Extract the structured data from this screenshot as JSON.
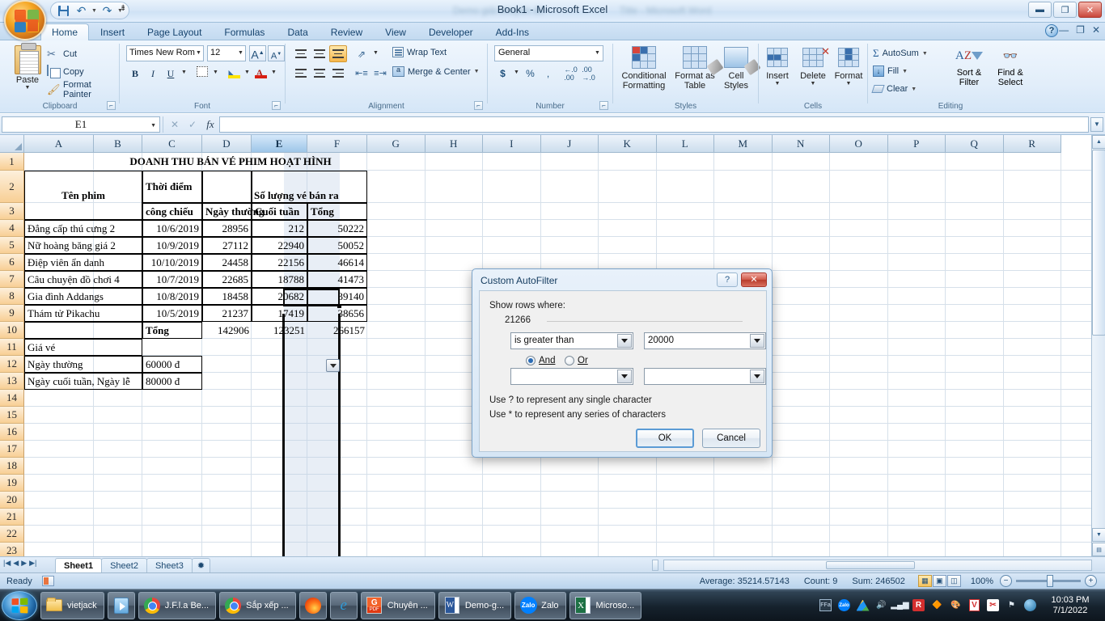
{
  "titlebar": {
    "app_title": "Book1 - Microsoft Excel",
    "blur_left": "Demo giải chuyên đề",
    "blur_right": "Title - Microsoft Word",
    "quick_access": [
      "save-icon",
      "undo-icon",
      "redo-icon",
      "customize-icon"
    ],
    "window_buttons": [
      "minimize",
      "restore",
      "close"
    ]
  },
  "ribbon": {
    "tabs": [
      {
        "label": "Home",
        "active": true
      },
      {
        "label": "Insert",
        "active": false
      },
      {
        "label": "Page Layout",
        "active": false
      },
      {
        "label": "Formulas",
        "active": false
      },
      {
        "label": "Data",
        "active": false
      },
      {
        "label": "Review",
        "active": false
      },
      {
        "label": "View",
        "active": false
      },
      {
        "label": "Developer",
        "active": false
      },
      {
        "label": "Add-Ins",
        "active": false
      }
    ],
    "clipboard": {
      "group_label": "Clipboard",
      "paste": "Paste",
      "cut": "Cut",
      "copy": "Copy",
      "format_painter": "Format Painter"
    },
    "font": {
      "group_label": "Font",
      "font_name": "Times New Rom",
      "font_size": "12",
      "bold": "B",
      "italic": "I",
      "underline": "U"
    },
    "alignment": {
      "group_label": "Alignment",
      "wrap_text": "Wrap Text",
      "merge_center": "Merge & Center"
    },
    "number": {
      "group_label": "Number",
      "format": "General",
      "currency": "$",
      "percent": "%",
      "comma": ","
    },
    "styles": {
      "group_label": "Styles",
      "conditional_formatting": "Conditional Formatting",
      "format_as_table": "Format as Table",
      "cell_styles": "Cell Styles"
    },
    "cells": {
      "group_label": "Cells",
      "insert": "Insert",
      "delete": "Delete",
      "format": "Format"
    },
    "editing": {
      "group_label": "Editing",
      "autosum": "AutoSum",
      "fill": "Fill",
      "clear": "Clear",
      "sort_filter": "Sort & Filter",
      "find_select": "Find & Select"
    }
  },
  "formula_bar": {
    "name_box": "E1",
    "formula_value": ""
  },
  "grid": {
    "columns": [
      "A",
      "B",
      "C",
      "D",
      "E",
      "F",
      "G",
      "H",
      "I",
      "J",
      "K",
      "L",
      "M",
      "N",
      "O",
      "P",
      "Q",
      "R"
    ],
    "selected_column": "E",
    "rows": [
      1,
      2,
      3,
      4,
      5,
      6,
      7,
      8,
      9,
      10,
      11,
      12,
      13,
      14,
      15,
      16,
      17,
      18,
      19,
      20,
      21,
      22,
      23
    ],
    "title_cell": "DOANH THU BÁN VÉ PHIM HOẠT HÌNH",
    "headers": {
      "ten_phim": "Tên phim",
      "thoi_diem": "Thời điểm",
      "cong_chieu": "công chiếu",
      "so_luong": "Số lượng vé bán ra",
      "ngay_thuong": "Ngày thường",
      "cuoi_tuan": "Cuối tuần",
      "tong": "Tổng"
    },
    "data_rows": [
      {
        "row": 4,
        "name": "Đẳng cấp thú cưng 2",
        "date": "10/6/2019",
        "weekday": "28956",
        "weekend": "212",
        "total": "50222"
      },
      {
        "row": 5,
        "name": "Nữ hoàng băng giá 2",
        "date": "10/9/2019",
        "weekday": "27112",
        "weekend": "22940",
        "total": "50052"
      },
      {
        "row": 6,
        "name": "Điệp viên ẩn danh",
        "date": "10/10/2019",
        "weekday": "24458",
        "weekend": "22156",
        "total": "46614"
      },
      {
        "row": 7,
        "name": "Câu chuyện đồ chơi 4",
        "date": "10/7/2019",
        "weekday": "22685",
        "weekend": "18788",
        "total": "41473"
      },
      {
        "row": 8,
        "name": "Gia đình Addangs",
        "date": "10/8/2019",
        "weekday": "18458",
        "weekend": "20682",
        "total": "39140"
      },
      {
        "row": 9,
        "name": "Thám tử Pikachu",
        "date": "10/5/2019",
        "weekday": "21237",
        "weekend": "17419",
        "total": "38656"
      }
    ],
    "total_row": {
      "row": 10,
      "label": "Tổng",
      "weekday": "142906",
      "weekend": "123251",
      "total": "266157"
    },
    "price_section": [
      {
        "row": 11,
        "label": "Giá vé",
        "value": ""
      },
      {
        "row": 12,
        "label": "Ngày thường",
        "value": "60000 đ"
      },
      {
        "row": 13,
        "label": "Ngày cuối tuần, Ngày lễ",
        "value": "80000 đ"
      }
    ]
  },
  "dialog": {
    "title": "Custom AutoFilter",
    "show_rows_where": "Show rows where:",
    "field_name": "21266",
    "condition1": "is greater than",
    "value1": "20000",
    "and_label": "And",
    "or_label": "Or",
    "and_selected": true,
    "condition2": "",
    "value2": "",
    "hint1": "Use ? to represent any single character",
    "hint2": "Use * to represent any series of characters",
    "ok": "OK",
    "cancel": "Cancel",
    "help": "?",
    "close": "✕"
  },
  "sheet_tabs": {
    "tabs": [
      "Sheet1",
      "Sheet2",
      "Sheet3"
    ],
    "active": "Sheet1"
  },
  "status_bar": {
    "state": "Ready",
    "average": "Average: 35214.57143",
    "count": "Count: 9",
    "sum": "Sum: 246502",
    "zoom": "100%"
  },
  "taskbar": {
    "items": [
      {
        "label": "vietjack",
        "icon": "folder-icon"
      },
      {
        "label": "",
        "icon": "media-player-icon"
      },
      {
        "label": "J.F.l.a Be...",
        "icon": "chrome-icon"
      },
      {
        "label": "Sắp xếp ...",
        "icon": "chrome-icon"
      },
      {
        "label": "",
        "icon": "firefox-icon"
      },
      {
        "label": "",
        "icon": "internet-explorer-icon"
      },
      {
        "label": "Chuyên ...",
        "icon": "pdf-icon"
      },
      {
        "label": "Demo-g...",
        "icon": "word-icon"
      },
      {
        "label": "Zalo",
        "icon": "zalo-icon"
      },
      {
        "label": "Microso...",
        "icon": "excel-icon"
      }
    ],
    "clock_time": "10:03 PM",
    "clock_date": "7/1/2022"
  },
  "colors": {
    "accent": "#2a6bb5",
    "excel_green": "#1d7044",
    "row_header": "#f8cf95",
    "selection": "#9ec6e8"
  }
}
